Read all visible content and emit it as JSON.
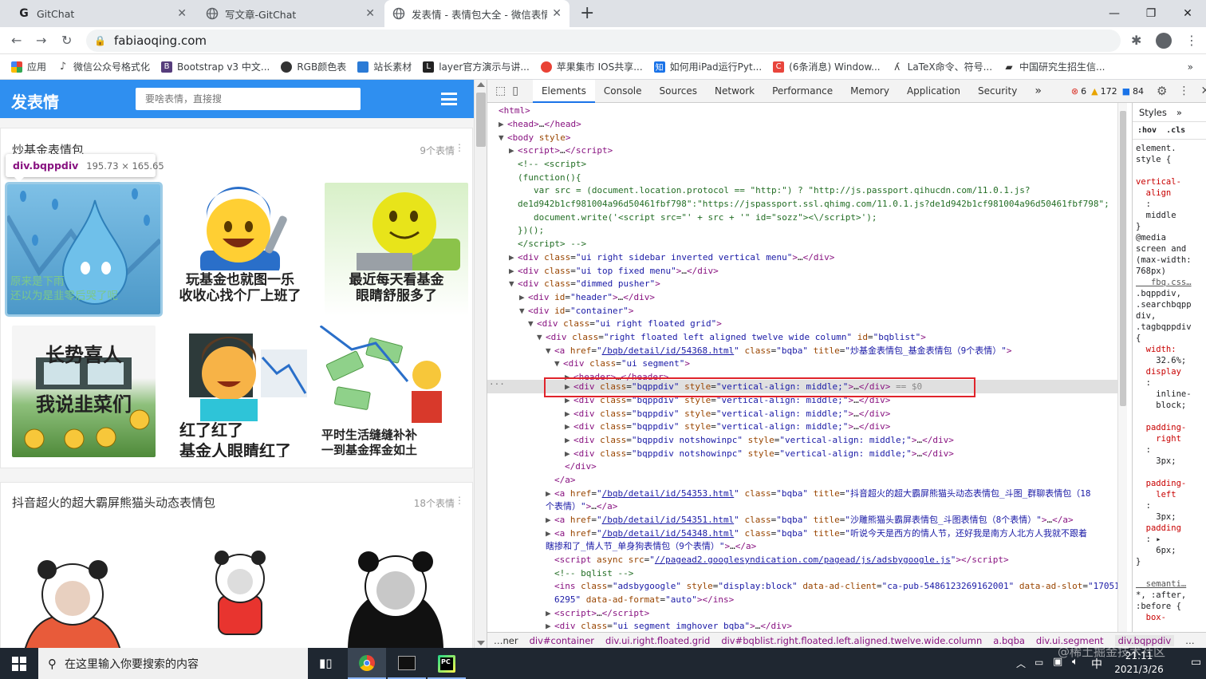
{
  "browser": {
    "tabs": [
      {
        "title": "GitChat",
        "icon": "G"
      },
      {
        "title": "写文章-GitChat",
        "icon": "globe"
      },
      {
        "title": "发表情 - 表情包大全 - 微信表情包",
        "icon": "globe"
      }
    ],
    "new_tab": "+",
    "url": "fabiaoqing.com",
    "bookmarks": [
      {
        "label": "应用",
        "color": "#e94235"
      },
      {
        "label": "微信公众号格式化",
        "color": "#555"
      },
      {
        "label": "Bootstrap v3 中文...",
        "color": "#563d7c",
        "icon": "B"
      },
      {
        "label": "RGB颜色表",
        "color": "#333"
      },
      {
        "label": "站长素材",
        "color": "#2b7bd6"
      },
      {
        "label": "layer官方演示与讲...",
        "color": "#222",
        "icon": "L"
      },
      {
        "label": "苹果集市 IOS共享...",
        "color": "#e94235"
      },
      {
        "label": "如何用iPad运行Pyt...",
        "color": "#1a73e8",
        "icon": "知"
      },
      {
        "label": "(6条消息) Window...",
        "color": "#e8453c",
        "icon": "C"
      },
      {
        "label": "LaTeX命令、符号...",
        "color": "#333"
      },
      {
        "label": "中国研究生招生信...",
        "color": "#333"
      }
    ],
    "more_bookmarks": "»"
  },
  "site": {
    "logo": "发表情",
    "search_placeholder": "要啥表情，直接搜",
    "inspect_tooltip": {
      "selector": "div.bqppdiv",
      "size": "195.73 × 165.65"
    },
    "packs": [
      {
        "title": "炒基金表情包",
        "count": "9个表情",
        "items": [
          {
            "caption": "原来是下雨\n还以为是韭零后哭了呢"
          },
          {
            "caption": "玩基金也就图一乐\n收收心找个厂上班了"
          },
          {
            "caption": "最近每天看基金\n眼睛舒服多了"
          },
          {
            "caption": "长势喜人\n我说韭菜们"
          },
          {
            "caption": "红了红了\n基金人眼睛红了"
          },
          {
            "caption": "平时生活缝缝补补\n一到基金挥金如土"
          }
        ]
      },
      {
        "title": "抖音超火的超大霸屏熊猫头动态表情包",
        "count": "18个表情"
      }
    ]
  },
  "devtools": {
    "tabs": [
      "Elements",
      "Console",
      "Sources",
      "Network",
      "Performance",
      "Memory",
      "Application",
      "Security"
    ],
    "more": "»",
    "errors": "6",
    "warnings": "172",
    "messages": "84",
    "styles_tabs": [
      "Styles",
      "»"
    ],
    "styles_filter": ":hov  .cls",
    "styles_lines": [
      "element.",
      "style {",
      "",
      "vertical-",
      "  align",
      "  :",
      "  middle",
      "}",
      "@media",
      "screen and",
      "(max-width:",
      "768px)",
      "   fbq.css…",
      ".bqppdiv,",
      ".searchbqpp",
      "div,",
      ".tagbqppdiv",
      "{",
      "  width:",
      "    32.6%;",
      "  display",
      "  :",
      "    inline-",
      "    block;",
      "",
      "  padding-",
      "    right",
      "  :",
      "    3px;",
      "",
      "  padding-",
      "    left",
      "  :",
      "    3px;",
      "  padding",
      "  : ▸",
      "    6px;",
      "}",
      "",
      "  semanti…",
      "*, :after,",
      ":before {",
      "  box-"
    ],
    "breadcrumb": [
      "…ner",
      "div#container",
      "div.ui.right.floated.grid",
      "div#bqblist.right.floated.left.aligned.twelve.wide.column",
      "a.bqba",
      "div.ui.segment",
      "div.bqppdiv",
      "…"
    ]
  },
  "taskbar": {
    "search_text": "在这里输入你要搜索的内容",
    "time": "21:11",
    "date": "2021/3/26",
    "ime": "中",
    "watermark": "@稀土掘金技术社区"
  }
}
